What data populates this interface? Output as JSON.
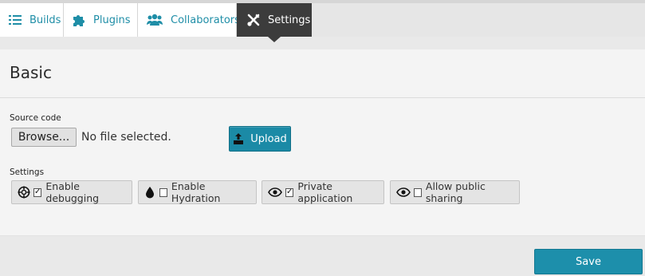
{
  "tabs": [
    {
      "label": "Builds",
      "icon": "list-icon"
    },
    {
      "label": "Plugins",
      "icon": "puzzle-icon"
    },
    {
      "label": "Collaborators",
      "icon": "users-icon"
    },
    {
      "label": "Settings",
      "icon": "wrench-screwdriver-icon",
      "active": true
    }
  ],
  "section": {
    "title": "Basic"
  },
  "source_code": {
    "label": "Source code",
    "browse_label": "Browse...",
    "file_status": "No file selected.",
    "upload_label": "Upload"
  },
  "settings": {
    "label": "Settings",
    "options": [
      {
        "label": "Enable debugging",
        "icon": "crosshair-icon",
        "checked": true
      },
      {
        "label": "Enable Hydration",
        "icon": "droplet-icon",
        "checked": false
      },
      {
        "label": "Private application",
        "icon": "eye-icon",
        "checked": true
      },
      {
        "label": "Allow public sharing",
        "icon": "eye-icon",
        "checked": false
      }
    ]
  },
  "footer": {
    "save_label": "Save"
  },
  "colors": {
    "accent": "#1b8aa6",
    "active_tab": "#3c3c3c"
  }
}
